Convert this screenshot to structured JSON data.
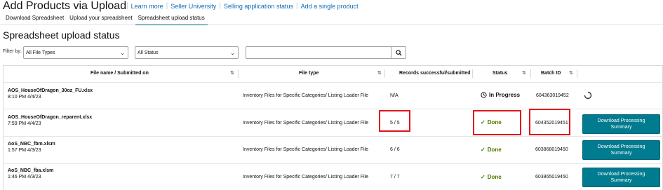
{
  "header": {
    "title": "Add Products via Upload",
    "links": [
      "Learn more",
      "Seller University",
      "Selling application status",
      "Add a single product"
    ]
  },
  "tabs": [
    "Download Spreadsheet",
    "Upload your spreadsheet",
    "Spreadsheet upload status"
  ],
  "section_title": "Spreadsheet upload status",
  "filters": {
    "label": "Filter by:",
    "file_type": "All File Types",
    "status": "All Status",
    "search_value": ""
  },
  "table": {
    "columns": {
      "file": "File name / Submitted on",
      "type": "File type",
      "records": "Records successful/submitted",
      "status": "Status",
      "batch": "Batch ID"
    },
    "rows": [
      {
        "name": "AOS_HouseOfDragon_30oz_FU.xlsx",
        "date": "8:10 PM 4/4/23",
        "type": "Inventory Files for Specific Categories/ Listing Loader File",
        "records": "N/A",
        "status": "In Progress",
        "batch": "604363019452",
        "action": ""
      },
      {
        "name": "AOS_HouseOfDragon_reparent.xlsx",
        "date": "7:59 PM 4/4/23",
        "type": "Inventory Files for Specific Categories/ Listing Loader File",
        "records": "5 / 5",
        "status": "Done",
        "batch": "604352019451",
        "action": "Download Processing Summary"
      },
      {
        "name": "AoS_NBC_fbm.xlsm",
        "date": "1:57 PM 4/3/23",
        "type": "Inventory Files for Specific Categories/ Listing Loader File",
        "records": "6 / 6",
        "status": "Done",
        "batch": "603868019450",
        "action": "Download Processing Summary"
      },
      {
        "name": "AoS_NBC_fba.xlsm",
        "date": "1:46 PM 4/3/23",
        "type": "Inventory Files for Specific Categories/ Listing Loader File",
        "records": "7 / 7",
        "status": "Done",
        "batch": "603865019450",
        "action": "Download Processing Summary"
      }
    ]
  },
  "colors": {
    "accent": "#008296",
    "button": "#007b8f",
    "done": "#4a7a00",
    "highlight": "#e0141b"
  }
}
